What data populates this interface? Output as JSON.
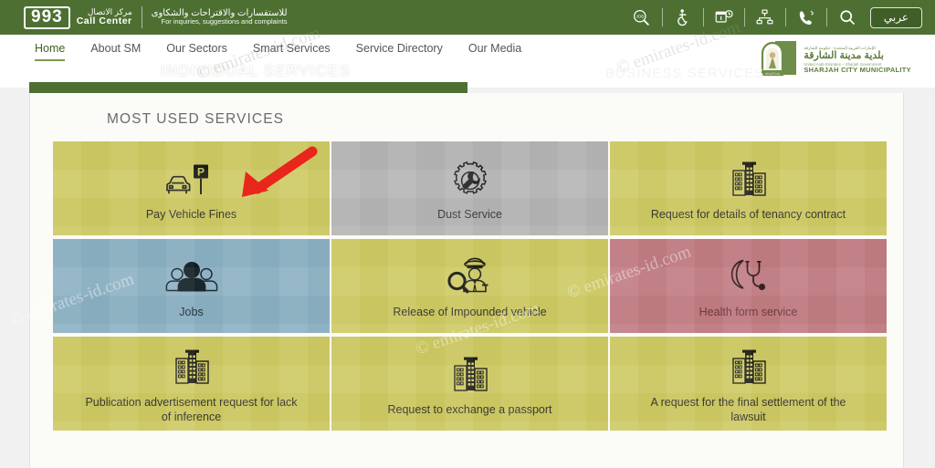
{
  "topbar": {
    "call_center": {
      "number": "993",
      "label_ar": "مركز الاتصال",
      "label_en": "Call Center",
      "tagline_ar": "للاستفسارات والاقتراحات والشكاوى",
      "tagline_en": "For inquiries, suggestions and complaints"
    },
    "icons": [
      {
        "name": "job-search-icon",
        "title": "Jobs"
      },
      {
        "name": "accessibility-icon",
        "title": "Accessibility"
      },
      {
        "name": "working-hours-icon",
        "title": "Working hours"
      },
      {
        "name": "sitemap-icon",
        "title": "Sitemap"
      },
      {
        "name": "contact-phone-icon",
        "title": "Contact us"
      },
      {
        "name": "search-icon",
        "title": "Search"
      }
    ],
    "language_button": "عربي"
  },
  "nav": {
    "items": [
      {
        "label": "Home",
        "active": true
      },
      {
        "label": "About SM",
        "active": false
      },
      {
        "label": "Our Sectors",
        "active": false
      },
      {
        "label": "Smart Services",
        "active": false
      },
      {
        "label": "Service Directory",
        "active": false
      },
      {
        "label": "Our Media",
        "active": false
      }
    ]
  },
  "logo": {
    "line_ar_top": "الإمارات العربية المتحدة - حكومة الشارقة",
    "line_ar_main": "بلدية مدينة الشارقة",
    "line_en_top": "United Arab Emirates – Sharjah Government",
    "line_en_main": "SHARJAH CITY MUNICIPALITY"
  },
  "service_tabs": {
    "individual": "INDIVIDUAL SERVICES",
    "business": "BUSINESS SERVICES"
  },
  "main": {
    "section_title": "MOST USED SERVICES",
    "tiles": [
      {
        "label": "Pay Vehicle Fines",
        "icon": "car-parking-sign-icon",
        "color": "#cdc963",
        "variant": "yellow"
      },
      {
        "label": "Dust Service",
        "icon": "gear-wrench-icon",
        "color": "#b4b4b4",
        "variant": "gray"
      },
      {
        "label": "Request for details of tenancy contract",
        "icon": "building-icon",
        "color": "#cdc963",
        "variant": "yellow"
      },
      {
        "label": "Jobs",
        "icon": "people-group-icon",
        "color": "#8bb0c2",
        "variant": "blue"
      },
      {
        "label": "Release of Impounded vehicle",
        "icon": "officer-magnifier-icon",
        "color": "#cdc963",
        "variant": "yellow"
      },
      {
        "label": "Health form service",
        "icon": "stethoscope-crescent-icon",
        "color": "#c07b82",
        "variant": "rose"
      },
      {
        "label": "Publication advertisement request for lack of inference",
        "icon": "building-icon",
        "color": "#cdc963",
        "variant": "yellow"
      },
      {
        "label": "Request to exchange a passport",
        "icon": "building-icon",
        "color": "#cdc963",
        "variant": "yellow"
      },
      {
        "label": "A request for the final settlement of the lawsuit",
        "icon": "building-icon",
        "color": "#cdc963",
        "variant": "yellow"
      }
    ]
  },
  "annotation": {
    "arrow": "red-arrow-pointing-to-pay-vehicle-fines",
    "color": "#e8261c"
  },
  "watermark": {
    "text": "© emirates-id.com"
  },
  "colors": {
    "header_green": "#4d7032",
    "tile_yellow": "#cdc963",
    "tile_gray": "#b4b4b4",
    "tile_blue": "#8bb0c2",
    "tile_rose": "#c07b82",
    "card_bg": "#fbfbf7",
    "page_bg": "#f1f1f1"
  }
}
